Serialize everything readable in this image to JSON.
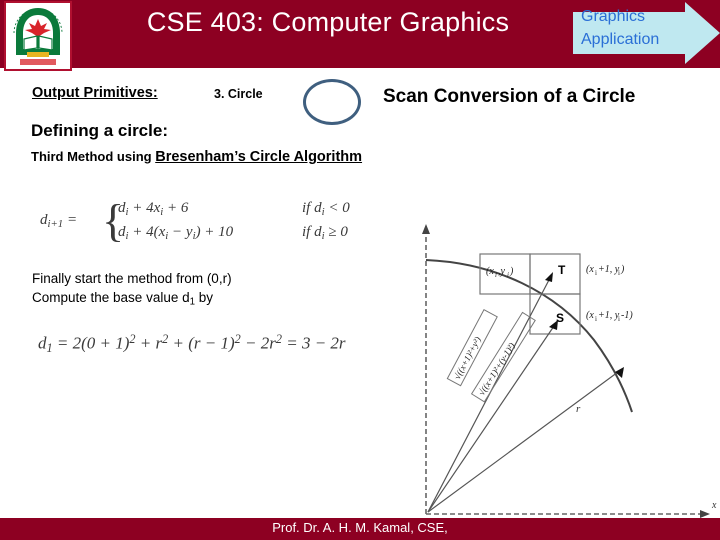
{
  "header": {
    "title": "CSE 403: Computer Graphics",
    "banner_label": "Graphics\nApplication",
    "banner_line1": "Graphics",
    "banner_line2": "Application",
    "bar_color": "#8d0022",
    "banner_fill": "#bfe8f0",
    "banner_text_color": "#2a6fd6",
    "logo_name": "jkkniu-university-logo"
  },
  "subhead": {
    "section_label": "Output Primitives:",
    "topic_number": "3. Circle",
    "slide_title": "Scan Conversion of a Circle",
    "circle_glyph_color": "#3f5f7f"
  },
  "body": {
    "defining_heading": "Defining a circle:",
    "method_prefix": "Third Method using ",
    "method_name": "Bresenham’s Circle Algorithm",
    "paragraph_line1": "Finally start the method from (0,r)",
    "paragraph_line2_prefix": "Compute the base value d",
    "paragraph_line2_sub": "1",
    "paragraph_line2_suffix": " by"
  },
  "equation_piecewise": {
    "lhs": "d",
    "lhs_sub": "i+1",
    "lhs_eq": " = ",
    "case1": "dᵢ + 4xᵢ + 6",
    "case1_plain": "d",
    "case1_rest": " + 4x",
    "case1_tail": " + 6",
    "case2_plain": "d",
    "case2_rest": " + 4(x",
    "case2_mid": " − y",
    "case2_tail": ") + 10",
    "condition1": "if dᵢ < 0",
    "condition2": "if dᵢ ≥ 0",
    "cond1_prefix": "if d",
    "cond1_suffix": " < 0",
    "cond2_prefix": "if d",
    "cond2_suffix": " ≥ 0",
    "sub_i": "i"
  },
  "equation_base": {
    "full": "d₁ = 2(0 + 1)² + r² + (r − 1)² − 2r² = 3 − 2r",
    "lhs": "d",
    "lhs_sub": "1",
    "rhs_a": " = 2(0 + 1)",
    "sup2_a": "2",
    "rhs_b": " + r",
    "sup2_b": "2",
    "rhs_c": " + (r − 1)",
    "sup2_c": "2",
    "rhs_d": " − 2r",
    "sup2_d": "2",
    "rhs_e": " = 3 − 2r"
  },
  "diagram": {
    "name": "bresenham-circle-decision-diagram",
    "axis_x_label": "x",
    "label_xi_yi": "(xᵢ,yᵢ)",
    "label_T": "T",
    "label_S": "S",
    "label_xi1_yi": "(xᵢ+1, yᵢ)",
    "label_xi1_yi_minus1": "(xᵢ+1, yᵢ-1)",
    "label_radius": "r",
    "label_dist_T": "√((xᵢ+1)²+yᵢ²)",
    "label_dist_S": "√((xᵢ+1)²+(yᵢ-1)²)",
    "stroke_color": "#555555"
  },
  "footer": {
    "text": "Prof. Dr. A. H. M. Kamal, CSE,",
    "bar_color": "#8d0022"
  }
}
